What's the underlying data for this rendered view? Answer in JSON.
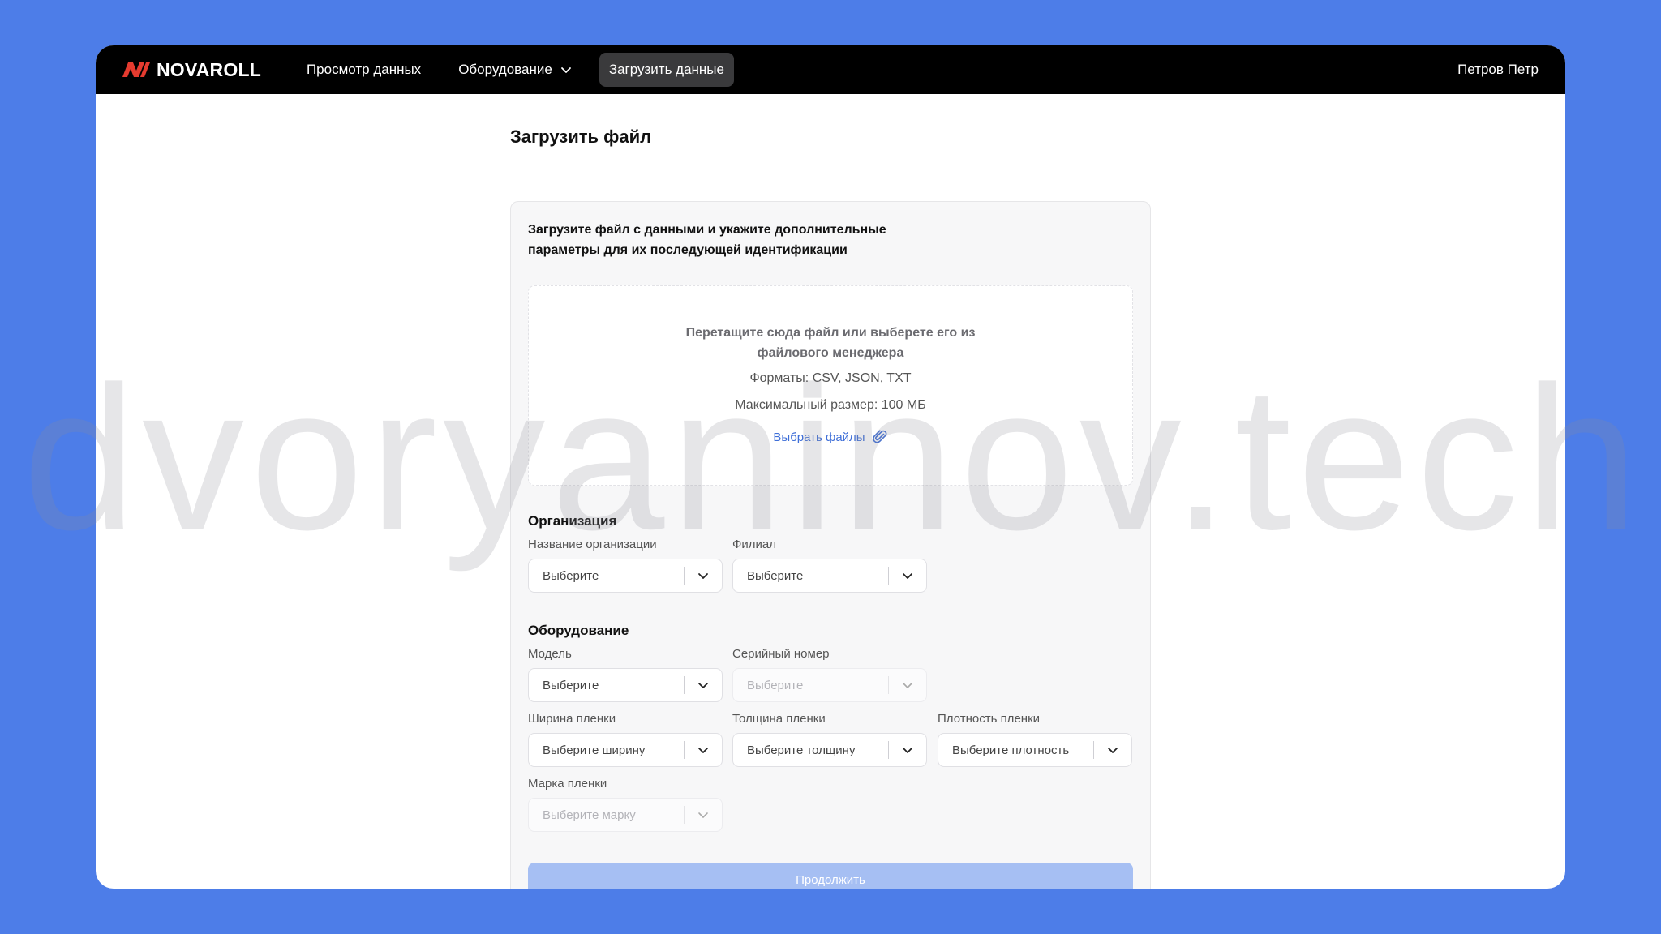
{
  "brand": {
    "name": "NOVAROLL",
    "accent": "#e53b2f"
  },
  "nav": {
    "items": [
      {
        "label": "Просмотр данных"
      },
      {
        "label": "Оборудование",
        "icon": "chevron-down-icon"
      },
      {
        "label": "Загрузить данные",
        "active": true
      }
    ],
    "user": "Петров Петр"
  },
  "page": {
    "title": "Загрузить файл"
  },
  "form": {
    "intro": "Загрузите файл с данными и укажите дополнительные параметры для их последующей идентификации",
    "dropzone": {
      "main": "Перетащите сюда файл или выберете его из файлового менеджера",
      "formats": "Форматы: CSV, JSON, TXT",
      "max_size": "Максимальный размер: 100 МБ",
      "pick_label": "Выбрать файлы",
      "pick_icon": "paperclip-icon"
    },
    "organization": {
      "title": "Организация",
      "org_name": {
        "label": "Название организации",
        "value": "Выберите"
      },
      "branch": {
        "label": "Филиал",
        "value": "Выберите"
      }
    },
    "equipment": {
      "title": "Оборудование",
      "model": {
        "label": "Модель",
        "value": "Выберите"
      },
      "serial": {
        "label": "Серийный номер",
        "value": "Выберите",
        "disabled": true
      },
      "film_width": {
        "label": "Ширина пленки",
        "value": "Выберите ширину"
      },
      "film_thickness": {
        "label": "Толщина пленки",
        "value": "Выберите толщину"
      },
      "film_density": {
        "label": "Плотность пленки",
        "value": "Выберите плотность"
      },
      "film_brand": {
        "label": "Марка пленки",
        "value": "Выберите марку",
        "disabled": true
      }
    },
    "continue_label": "Продолжить"
  },
  "watermark": "dvoryaninov.tech",
  "colors": {
    "background": "#4d7de8",
    "navbar": "#000000",
    "link": "#3f6fd8",
    "button_disabled": "#a6bff3"
  }
}
